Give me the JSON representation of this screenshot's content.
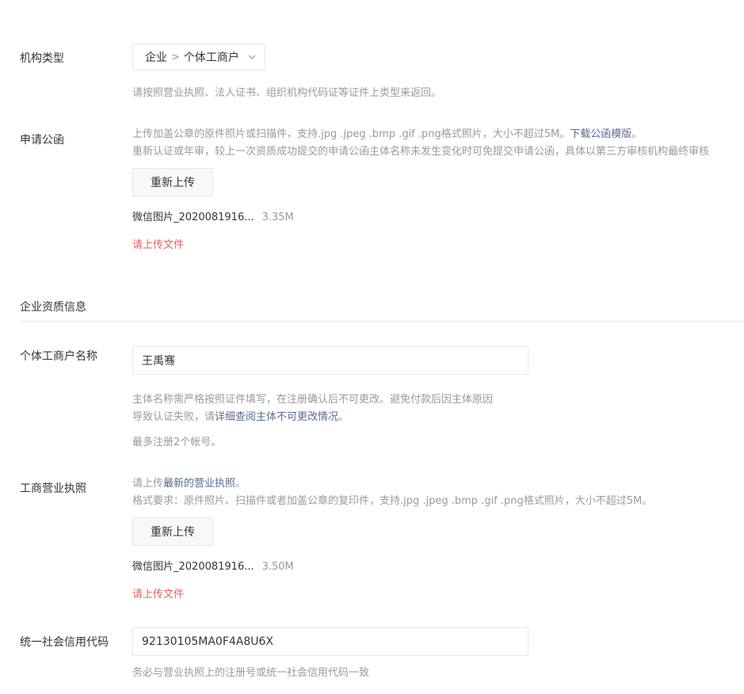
{
  "org_type": {
    "label": "机构类型",
    "select_level1": "企业",
    "select_separator": ">",
    "select_level2": "个体工商户",
    "chevron_icon": "chevron-down-icon",
    "tip": "请按照营业执照、法人证书、组织机构代码证等证件上类型来返回。"
  },
  "application_letter": {
    "label": "申请公函",
    "tip1_text": "上传加盖公章的原件照片或扫描件，支持.jpg .jpeg .bmp .gif .png格式照片，大小不超过5M。",
    "tip1_link": "下载公函模版",
    "tip1_suffix": "。",
    "tip2_text": "重新认证或年审，较上一次资质成功提交的申请公函主体名称未发生变化时可免提交申请公函，具体以第三方审核机构最终审核",
    "upload_button": "重新上传",
    "file_name": "微信图片_2020081916...",
    "file_size": "3.35M",
    "error": "请上传文件"
  },
  "section": {
    "title": "企业资质信息"
  },
  "merchant_name": {
    "label": "个体工商户名称",
    "value": "王禹骞",
    "tip1": "主体名称需严格按照证件填写，在注册确认后不可更改。避免付款后因主体原因",
    "tip2_prefix": "导致认证失败，请",
    "tip2_link": "详细查阅主体不可更改情况",
    "tip2_suffix": "。",
    "tip3": "最多注册2个帐号。"
  },
  "business_license": {
    "label": "工商营业执照",
    "tip1_prefix": "请上传",
    "tip1_link": "最新的营业执照",
    "tip1_suffix": "。",
    "tip2": "格式要求：原件照片、扫描件或者加盖公章的复印件，支持.jpg .jpeg .bmp .gif .png格式照片，大小不超过5M。",
    "upload_button": "重新上传",
    "file_name": "微信图片_2020081916...",
    "file_size": "3.50M",
    "error": "请上传文件"
  },
  "credit_code": {
    "label": "统一社会信用代码",
    "value": "92130105MA0F4A8U6X",
    "tip": "务必与营业执照上的注册号或统一社会信用代码一致"
  },
  "colors": {
    "text": "#353535",
    "tip": "#9a9a9a",
    "link": "#576b95",
    "error": "#e15f63",
    "border": "#e4e8eb"
  }
}
